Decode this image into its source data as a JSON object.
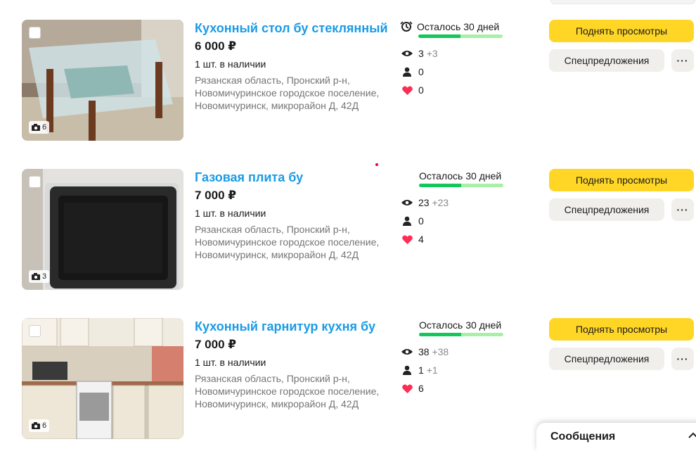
{
  "listings": [
    {
      "title": "Кухонный стол бу стеклянный",
      "price": "6 000 ₽",
      "stock": "1 шт. в наличии",
      "address": [
        "Рязанская область, Пронский р-н,",
        "Новомичуринское городское поселение,",
        "Новомичуринск, микрорайон Д, 42Д"
      ],
      "photo_count": "6",
      "days_left": "Осталось 30 дней",
      "days_progress": 0.5,
      "views": "3",
      "views_delta": "+3",
      "contacts": "0",
      "contacts_delta": "",
      "favorites": "0",
      "raise_label": "Поднять просмотры",
      "special_label": "Спецпредложения",
      "more_label": "···"
    },
    {
      "title": "Газовая плита бу",
      "price": "7 000 ₽",
      "stock": "1 шт. в наличии",
      "address": [
        "Рязанская область, Пронский р-н,",
        "Новомичуринское городское поселение,",
        "Новомичуринск, микрорайон Д, 42Д"
      ],
      "photo_count": "3",
      "days_left": "Осталось 30 дней",
      "days_progress": 0.5,
      "views": "23",
      "views_delta": "+23",
      "contacts": "0",
      "contacts_delta": "",
      "favorites": "4",
      "raise_label": "Поднять просмотры",
      "special_label": "Спецпредложения",
      "more_label": "···"
    },
    {
      "title": "Кухонный гарнитур кухня бу",
      "price": "7 000 ₽",
      "stock": "1 шт. в наличии",
      "address": [
        "Рязанская область, Пронский р-н,",
        "Новомичуринское городское поселение,",
        "Новомичуринск, микрорайон Д, 42Д"
      ],
      "photo_count": "6",
      "days_left": "Осталось 30 дней",
      "days_progress": 0.5,
      "views": "38",
      "views_delta": "+38",
      "contacts": "1",
      "contacts_delta": "+1",
      "favorites": "6",
      "raise_label": "Поднять просмотры",
      "special_label": "Спецпредложения",
      "more_label": "···"
    }
  ],
  "messages_panel": {
    "title": "Сообщения"
  },
  "colors": {
    "title_link": "#1a9be6",
    "raise_button": "#ffd626",
    "secondary_button": "#f0efeb",
    "days_fill": "#12c85a",
    "days_track": "#a8f0a8",
    "favorite_heart": "#ff2d55"
  },
  "icons": [
    "camera-icon",
    "eye-icon",
    "person-icon",
    "heart-icon",
    "days-timer-icon",
    "chevron-up-icon"
  ]
}
